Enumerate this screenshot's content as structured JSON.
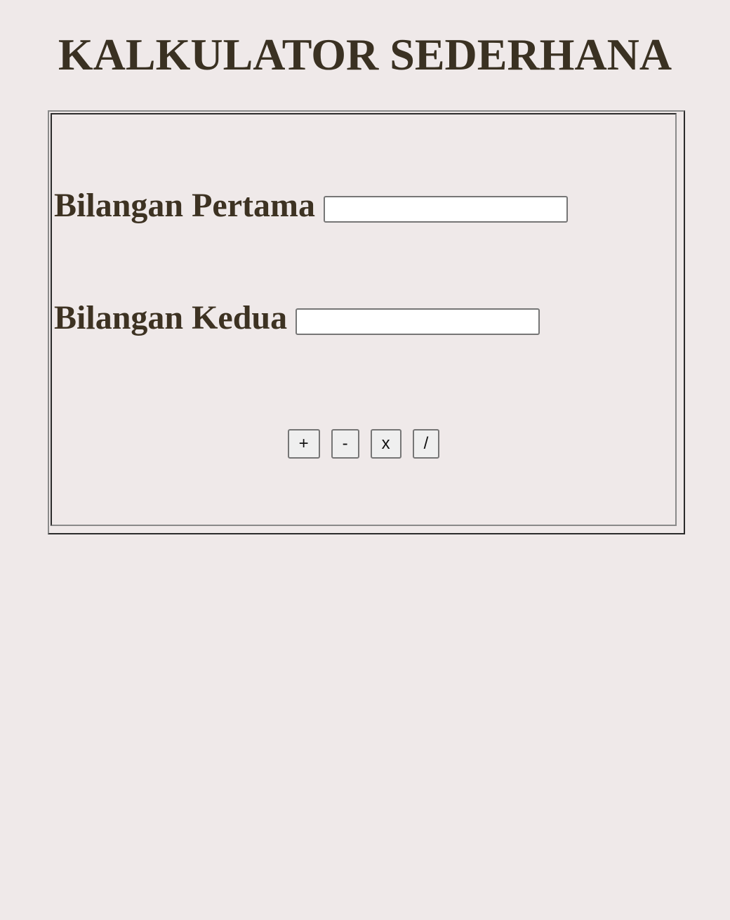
{
  "header": {
    "title": "KALKULATOR SEDERHANA"
  },
  "form": {
    "first_label": "Bilangan Pertama",
    "first_value": "",
    "second_label": "Bilangan Kedua",
    "second_value": "",
    "operations": {
      "add": "+",
      "subtract": "-",
      "multiply": "x",
      "divide": "/"
    }
  },
  "colors": {
    "background": "#efe9e9",
    "title_text": "#3a3122",
    "label_text": "#3d3222"
  }
}
